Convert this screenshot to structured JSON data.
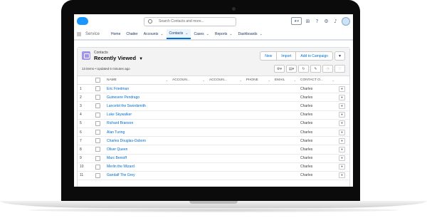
{
  "header": {
    "search_placeholder": "Search Contacts and more...",
    "icons": [
      "star-icon",
      "add-icon",
      "help-icon",
      "gear-icon",
      "bell-icon",
      "avatar"
    ]
  },
  "nav": {
    "app_name": "Service",
    "items": [
      {
        "label": "Home",
        "caret": false,
        "active": false
      },
      {
        "label": "Chatter",
        "caret": false,
        "active": false
      },
      {
        "label": "Accounts",
        "caret": true,
        "active": false
      },
      {
        "label": "Contacts",
        "caret": true,
        "active": true
      },
      {
        "label": "Cases",
        "caret": true,
        "active": false
      },
      {
        "label": "Reports",
        "caret": true,
        "active": false
      },
      {
        "label": "Dashboards",
        "caret": true,
        "active": false
      }
    ]
  },
  "list": {
    "object_label": "Contacts",
    "view_name": "Recently Viewed",
    "meta": "13 items • Updated 6 minutes ago",
    "buttons": {
      "new": "New",
      "import": "Import",
      "add_to_campaign": "Add to Campaign"
    },
    "columns": [
      "NAME",
      "ACCOUN...",
      "ACCOUN...",
      "PHONE",
      "EMAIL",
      "CONTACT O..."
    ],
    "rows": [
      {
        "num": "1",
        "name": "Eric Friedman",
        "owner": "Charles"
      },
      {
        "num": "2",
        "name": "Guinevere Pendrago",
        "owner": "Charles"
      },
      {
        "num": "3",
        "name": "Lancelot the Swordsmith",
        "owner": "Charles"
      },
      {
        "num": "4",
        "name": "Luke Skywalker",
        "owner": "Charles"
      },
      {
        "num": "5",
        "name": "Richard Branson",
        "owner": "Charles"
      },
      {
        "num": "6",
        "name": "Alan Turing",
        "owner": "Charles"
      },
      {
        "num": "7",
        "name": "Charles Douglas-Osborn",
        "owner": "Charles"
      },
      {
        "num": "8",
        "name": "Oliver Queen",
        "owner": "Charles"
      },
      {
        "num": "9",
        "name": "Marc Benioff",
        "owner": "Charles"
      },
      {
        "num": "10",
        "name": "Merlin the Wizard",
        "owner": "Charles"
      },
      {
        "num": "11",
        "name": "Gandalf The Grey",
        "owner": "Charles"
      }
    ]
  },
  "colors": {
    "brand": "#1b96ff",
    "link": "#006dcc",
    "nav_active": "#0070d2",
    "object_icon": "#a094ed"
  }
}
